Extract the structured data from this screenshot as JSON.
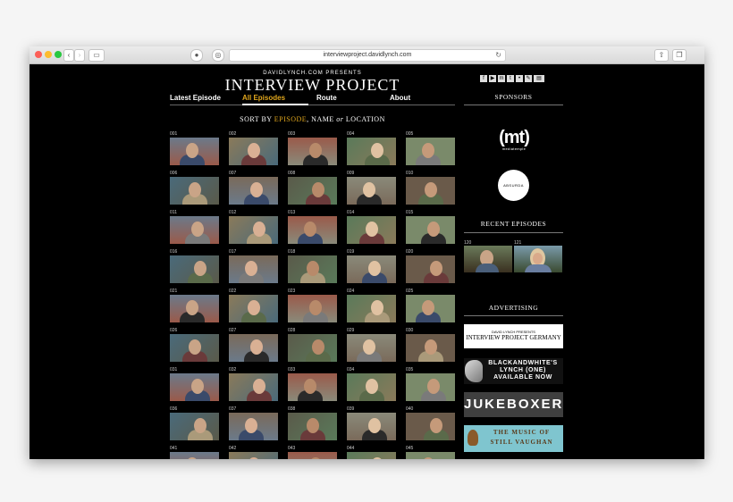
{
  "browser": {
    "url": "interviewproject.davidlynch.com",
    "back_icon": "chevron-left-icon",
    "forward_icon": "chevron-right-icon"
  },
  "header": {
    "presents": "DAVIDLYNCH.COM PRESENTS",
    "title": "INTERVIEW PROJECT"
  },
  "nav": [
    {
      "label": "Latest Episode",
      "active": false
    },
    {
      "label": "All Episodes",
      "active": true
    },
    {
      "label": "Route",
      "active": false
    },
    {
      "label": "About",
      "active": false
    }
  ],
  "sort": {
    "prefix": "SORT BY",
    "option1": "EPISODE",
    "sep": ", NAME",
    "or": "or",
    "option3": "LOCATION"
  },
  "episodes": [
    "001",
    "002",
    "003",
    "004",
    "005",
    "006",
    "007",
    "008",
    "009",
    "010",
    "011",
    "012",
    "013",
    "014",
    "015",
    "016",
    "017",
    "018",
    "019",
    "020",
    "021",
    "022",
    "023",
    "024",
    "025",
    "026",
    "027",
    "028",
    "029",
    "030",
    "031",
    "032",
    "033",
    "034",
    "035",
    "036",
    "037",
    "038",
    "039",
    "040",
    "041",
    "042",
    "043",
    "044",
    "045"
  ],
  "sidebar": {
    "sponsors": "SPONSORS",
    "mt_logo": "(mt)",
    "mt_sub": "mediatemple",
    "absurda": "ABSURDA",
    "recent_title": "RECENT EPISODES",
    "recent": [
      "120",
      "121"
    ],
    "advertising": "ADVERTISING",
    "ad1_top": "DAVID LYNCH PRESENTS",
    "ad1_main": "INTERVIEW PROJECT GERMANY",
    "ad2": "BLACKANDWHITE'S LYNCH (ONE) AVAILABLE NOW",
    "ad3": "JUKEBOXER",
    "ad4_line1": "THE MUSIC OF",
    "ad4_line2": "STILL VAUGHAN"
  },
  "colors": {
    "accent": "#e0a61d",
    "background": "#000000"
  }
}
